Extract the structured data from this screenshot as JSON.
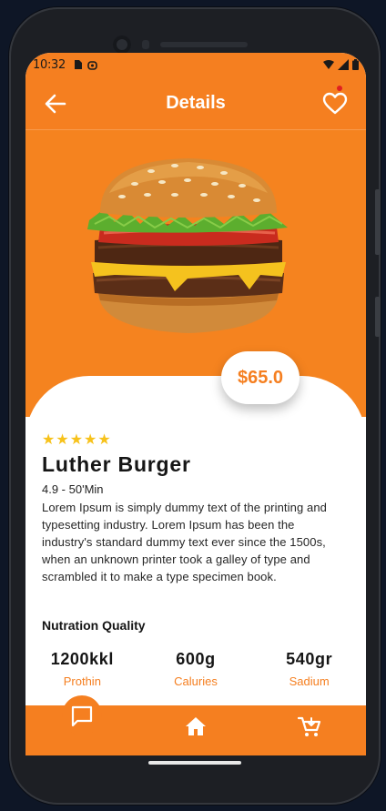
{
  "status_bar": {
    "time": "10:32"
  },
  "app_bar": {
    "title": "Details"
  },
  "product": {
    "price": "$65.0",
    "rating_stars": 5,
    "name": "Luther Burger",
    "rating_time": "4.9 - 50'Min",
    "description": "Lorem Ipsum is simply dummy text of the printing and typesetting industry. Lorem Ipsum has been the industry's standard dummy text ever since the 1500s, when an unknown printer took a galley of type and scrambled it to make a type specimen book."
  },
  "nutrition": {
    "title": "Nutration Quality",
    "items": [
      {
        "value": "1200kkl",
        "label": "Prothin"
      },
      {
        "value": "600g",
        "label": "Caluries"
      },
      {
        "value": "540gr",
        "label": "Sadium"
      }
    ]
  },
  "bottom_nav": {
    "items": [
      "chat-icon",
      "home-icon",
      "cart-icon"
    ]
  },
  "colors": {
    "accent": "#f57f20",
    "star": "#f7c21b"
  }
}
